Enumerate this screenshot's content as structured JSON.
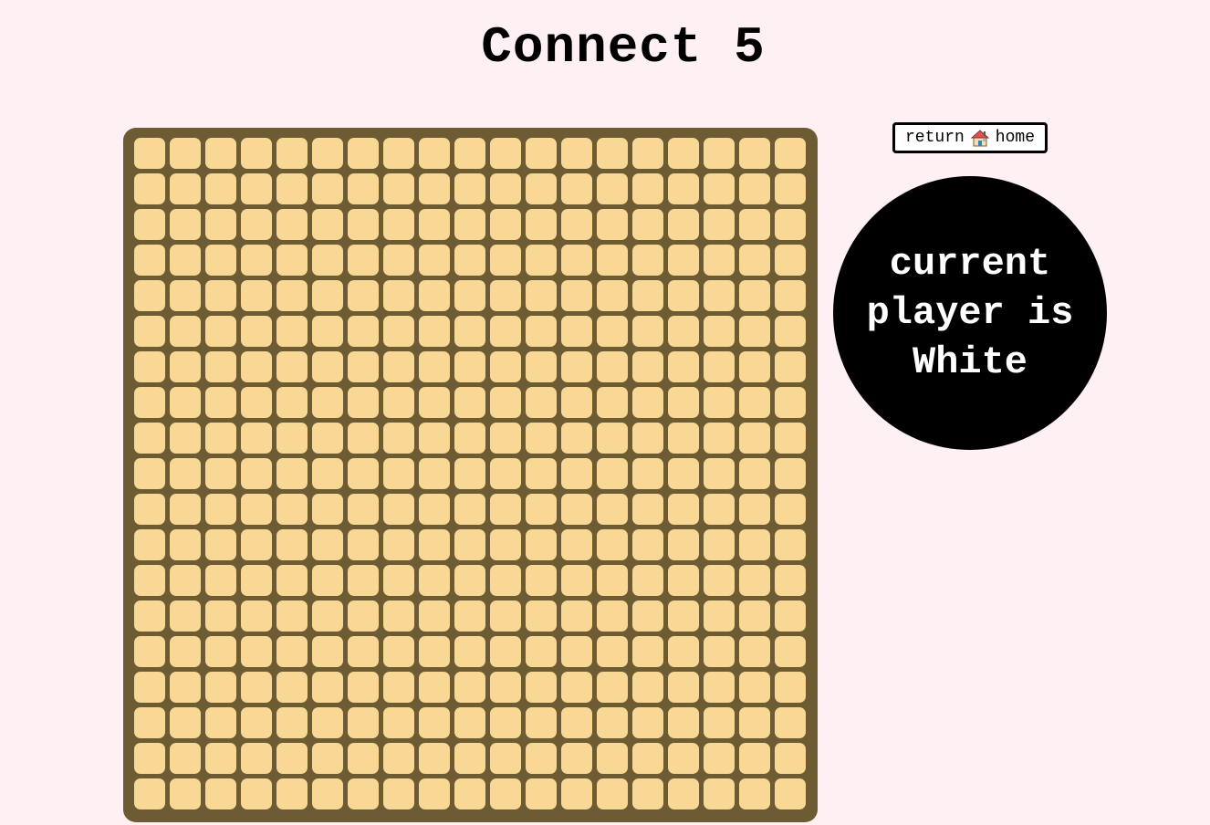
{
  "title": "Connect 5",
  "home_button": {
    "label_before": "return",
    "icon": "house-icon",
    "label_after": "home"
  },
  "status": {
    "line1": "current",
    "line2": "player is",
    "line3": "White"
  },
  "board": {
    "rows": 19,
    "columns": 19,
    "board_color": "#6d5b34",
    "cell_color": "#f8d894"
  },
  "colors": {
    "background": "#fff0f3",
    "indicator": "#000000",
    "indicator_text": "#ffffff"
  }
}
